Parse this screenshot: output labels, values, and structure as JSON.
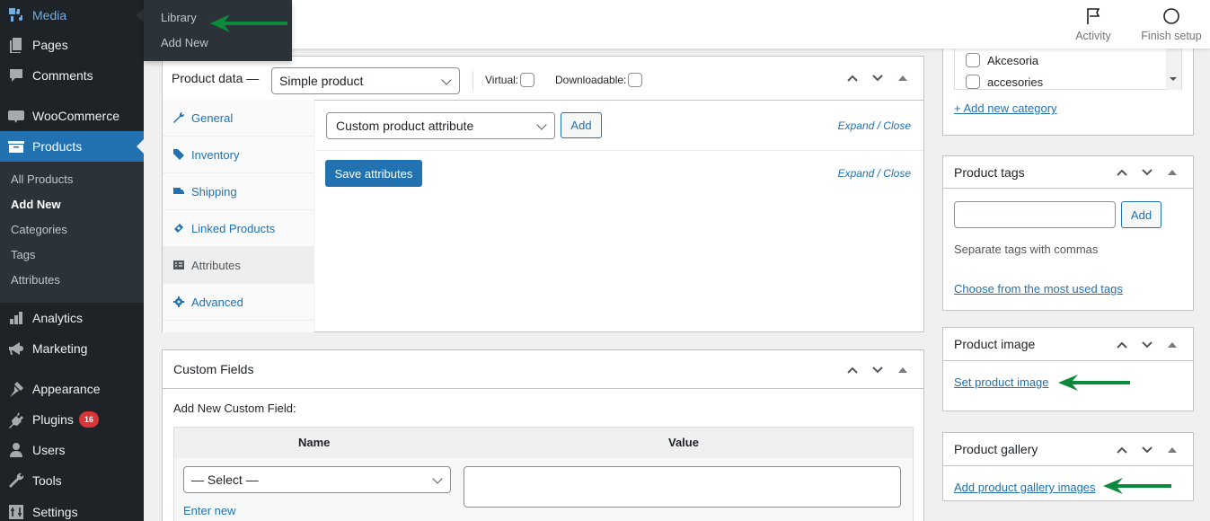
{
  "sidebar": {
    "items": [
      {
        "label": "Media",
        "icon": "media-icon"
      },
      {
        "label": "Pages",
        "icon": "pages-icon"
      },
      {
        "label": "Comments",
        "icon": "comments-icon"
      },
      {
        "label": "WooCommerce",
        "icon": "woocommerce-icon"
      },
      {
        "label": "Products",
        "icon": "products-icon"
      },
      {
        "label": "Analytics",
        "icon": "analytics-icon"
      },
      {
        "label": "Marketing",
        "icon": "megaphone-icon"
      },
      {
        "label": "Appearance",
        "icon": "paintbrush-icon"
      },
      {
        "label": "Plugins",
        "icon": "plugin-icon",
        "badge": "16"
      },
      {
        "label": "Users",
        "icon": "users-icon"
      },
      {
        "label": "Tools",
        "icon": "wrench-icon"
      },
      {
        "label": "Settings",
        "icon": "settings-icon"
      }
    ],
    "products_submenu": [
      "All Products",
      "Add New",
      "Categories",
      "Tags",
      "Attributes"
    ],
    "media_flyout": [
      "Library",
      "Add New"
    ]
  },
  "header": {
    "activity_label": "Activity",
    "finish_setup_label": "Finish setup"
  },
  "product_data": {
    "title": "Product data —",
    "type_value": "Simple product",
    "virtual_label": "Virtual:",
    "downloadable_label": "Downloadable:",
    "tabs": [
      {
        "label": "General",
        "icon": "wrench-icon"
      },
      {
        "label": "Inventory",
        "icon": "tag-icon"
      },
      {
        "label": "Shipping",
        "icon": "truck-icon"
      },
      {
        "label": "Linked Products",
        "icon": "link-icon"
      },
      {
        "label": "Attributes",
        "icon": "list-icon",
        "active": true
      },
      {
        "label": "Advanced",
        "icon": "gear-icon"
      }
    ],
    "attribute_select_value": "Custom product attribute",
    "add_label": "Add",
    "save_attributes_label": "Save attributes",
    "expand_close_label": "Expand / Close"
  },
  "custom_fields": {
    "title": "Custom Fields",
    "add_new_label": "Add New Custom Field:",
    "col_name": "Name",
    "col_value": "Value",
    "select_value": "— Select —",
    "enter_new_label": "Enter new"
  },
  "categories": {
    "items": [
      "Akcesoria",
      "accesories"
    ],
    "add_new_label": "+ Add new category"
  },
  "product_tags": {
    "title": "Product tags",
    "add_label": "Add",
    "input_value": "",
    "help_text": "Separate tags with commas",
    "choose_label": "Choose from the most used tags"
  },
  "product_image": {
    "title": "Product image",
    "set_label": "Set product image"
  },
  "product_gallery": {
    "title": "Product gallery",
    "add_label": "Add product gallery images"
  },
  "colors": {
    "accent": "#2271b1",
    "sidebar_bg": "#1d2327",
    "annotation_arrow": "#0a8a3a",
    "badge": "#d63638"
  }
}
